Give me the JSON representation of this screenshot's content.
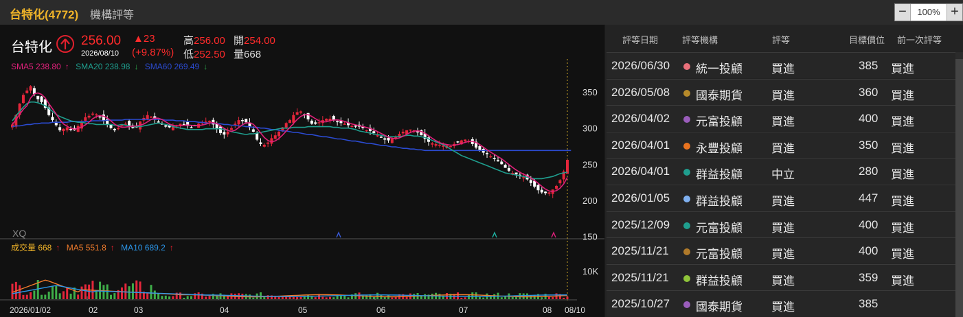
{
  "window": {
    "title": "台特化(4772)",
    "subtitle": "機構評等",
    "zoom_value": "100%",
    "zoom_minus": "−",
    "zoom_plus": "+"
  },
  "quote": {
    "name": "台特化",
    "price": "256.00",
    "date": "2026/08/10",
    "change": "▲23",
    "change_pct": "(+9.87%)",
    "high_label": "高",
    "high": "256.00",
    "open_label": "開",
    "open": "254.00",
    "low_label": "低",
    "low": "252.50",
    "vol_label": "量",
    "vol": "668"
  },
  "sma_legend": {
    "sma5": "SMA5 238.80",
    "sma20": "SMA20 238.98",
    "sma60": "SMA60 269.49",
    "up": "↑",
    "down": "↓"
  },
  "colors": {
    "up": "#e4263b",
    "down": "#ffffff",
    "sma5": "#e0207a",
    "sma20": "#1f9e8e",
    "sma60": "#2b4bd1",
    "vol": "#f0b429",
    "vma5": "#f07b2c",
    "vma10": "#2b95e8",
    "accent": "#f0b429",
    "signal_blue": "#3a5bd9",
    "signal_teal": "#1fb3a3",
    "signal_pink": "#e0207a"
  },
  "watermark": "XQ",
  "volume_legend": {
    "label": "成交量 668",
    "ma5": "MA5 551.8",
    "ma10": "MA10 689.2",
    "arrow": "↑"
  },
  "chart_data": {
    "type": "candlestick",
    "y_ticks": [
      "350",
      "300",
      "250",
      "200",
      "150"
    ],
    "y_range": [
      150,
      375
    ],
    "volume_tick": "10K",
    "x_ticks": [
      "2026/01/02",
      "02",
      "03",
      "04",
      "05",
      "06",
      "07",
      "08",
      "08/10"
    ],
    "close_series": [
      305,
      318,
      334,
      346,
      352,
      358,
      347,
      340,
      336,
      328,
      318,
      311,
      304,
      297,
      299,
      301,
      298,
      297,
      303,
      309,
      315,
      317,
      320,
      319,
      316,
      310,
      305,
      300,
      297,
      300,
      304,
      306,
      303,
      300,
      302,
      309,
      314,
      318,
      316,
      312,
      308,
      305,
      302,
      301,
      303,
      304,
      306,
      305,
      303,
      301,
      303,
      306,
      308,
      309,
      310,
      305,
      299,
      293,
      291,
      295,
      300,
      306,
      311,
      311,
      308,
      301,
      295,
      284,
      278,
      277,
      280,
      286,
      290,
      295,
      301,
      307,
      311,
      318,
      322,
      323,
      318,
      312,
      306,
      306,
      308,
      311,
      313,
      313,
      311,
      309,
      307,
      306,
      304,
      303,
      302,
      302,
      300,
      297,
      296,
      293,
      290,
      287,
      284,
      283,
      285,
      288,
      292,
      295,
      297,
      298,
      297,
      294,
      290,
      285,
      281,
      279,
      278,
      277,
      276,
      276,
      275,
      278,
      281,
      283,
      284,
      282,
      278,
      273,
      269,
      266,
      264,
      261,
      258,
      254,
      250,
      245,
      241,
      238,
      236,
      234,
      232,
      229,
      224,
      219,
      214,
      211,
      210,
      211,
      215,
      220,
      228,
      240,
      256
    ],
    "sma20_series": [
      310,
      317,
      323,
      329,
      334,
      336,
      336,
      335,
      333,
      331,
      327,
      323,
      319,
      316,
      314,
      312,
      310,
      309,
      308,
      308,
      307,
      306,
      306,
      305,
      305,
      305,
      305,
      305,
      304,
      304,
      305,
      304,
      303,
      302,
      302,
      302,
      303,
      304,
      305,
      306,
      307,
      306,
      305,
      304,
      302,
      301,
      300,
      299,
      298,
      298,
      298,
      298,
      298,
      299,
      299,
      299,
      299,
      299,
      298,
      297,
      295,
      294,
      293,
      292,
      291,
      292,
      292,
      293,
      294,
      295,
      296,
      297,
      298,
      299,
      300,
      300,
      300,
      301,
      301,
      301,
      301,
      302,
      302,
      302,
      302,
      302,
      302,
      302,
      301,
      301,
      300,
      300,
      300,
      299,
      298,
      296,
      295,
      294,
      293,
      292,
      291,
      290,
      289,
      288,
      288,
      288,
      288,
      289,
      290,
      290,
      289,
      289,
      288,
      287,
      285,
      283,
      281,
      279,
      277,
      274,
      271,
      268,
      265,
      262,
      260,
      258,
      256,
      254,
      252,
      250,
      248,
      246,
      244,
      242,
      240,
      238,
      237,
      236,
      235,
      234,
      233,
      232,
      231,
      230,
      230,
      230,
      231,
      232,
      233,
      235,
      237,
      238,
      239
    ],
    "sma60_series": [
      302,
      303,
      303,
      304,
      305,
      305,
      306,
      306,
      307,
      307,
      307,
      308,
      308,
      308,
      308,
      308,
      309,
      309,
      309,
      309,
      309,
      309,
      310,
      310,
      310,
      310,
      311,
      311,
      311,
      311,
      311,
      312,
      312,
      312,
      312,
      312,
      312,
      312,
      312,
      312,
      312,
      312,
      311,
      311,
      311,
      310,
      310,
      310,
      309,
      309,
      309,
      308,
      308,
      307,
      307,
      307,
      306,
      306,
      305,
      305,
      304,
      304,
      303,
      303,
      302,
      302,
      301,
      301,
      300,
      300,
      299,
      298,
      298,
      297,
      296,
      296,
      295,
      294,
      294,
      293,
      292,
      291,
      291,
      290,
      289,
      288,
      288,
      287,
      286,
      285,
      285,
      284,
      283,
      282,
      282,
      281,
      280,
      279,
      279,
      278,
      277,
      276,
      276,
      275,
      274,
      274,
      273,
      272,
      272,
      271,
      271,
      270,
      270,
      269,
      269,
      269,
      269,
      269,
      269,
      269,
      269,
      269,
      269,
      269,
      269,
      269,
      269,
      269,
      269,
      269,
      269,
      269,
      269,
      269,
      269,
      269,
      269,
      269,
      269,
      269,
      269,
      269,
      269,
      269,
      269,
      269,
      269,
      269,
      269,
      269,
      269,
      269,
      269,
      269
    ]
  },
  "table": {
    "headers": {
      "date": "評等日期",
      "org": "評等機構",
      "rating": "評等",
      "target": "目標價位",
      "prev": "前一次評等"
    },
    "rows": [
      {
        "date": "2026/06/30",
        "org": "統一投顧",
        "rating": "買進",
        "target": "385",
        "prev": "買進",
        "dot": "#e9707a"
      },
      {
        "date": "2026/05/08",
        "org": "國泰期貨",
        "rating": "買進",
        "target": "360",
        "prev": "買進",
        "dot": "#b68a2a"
      },
      {
        "date": "2026/04/02",
        "org": "元富投顧",
        "rating": "買進",
        "target": "400",
        "prev": "買進",
        "dot": "#9a5dbb"
      },
      {
        "date": "2026/04/01",
        "org": "永豐投顧",
        "rating": "買進",
        "target": "350",
        "prev": "買進",
        "dot": "#e8731f"
      },
      {
        "date": "2026/04/01",
        "org": "群益投顧",
        "rating": "中立",
        "target": "280",
        "prev": "買進",
        "dot": "#1f9e8e"
      },
      {
        "date": "2026/01/05",
        "org": "群益投顧",
        "rating": "買進",
        "target": "447",
        "prev": "買進",
        "dot": "#7fb0f0"
      },
      {
        "date": "2025/12/09",
        "org": "元富投顧",
        "rating": "買進",
        "target": "400",
        "prev": "買進",
        "dot": "#1f9e8e"
      },
      {
        "date": "2025/11/21",
        "org": "元富投顧",
        "rating": "買進",
        "target": "400",
        "prev": "買進",
        "dot": "#b07a2a"
      },
      {
        "date": "2025/11/21",
        "org": "群益投顧",
        "rating": "買進",
        "target": "359",
        "prev": "買進",
        "dot": "#8fc43a"
      },
      {
        "date": "2025/10/27",
        "org": "國泰期貨",
        "rating": "買進",
        "target": "385",
        "prev": "",
        "dot": "#9a5dbb"
      }
    ]
  }
}
